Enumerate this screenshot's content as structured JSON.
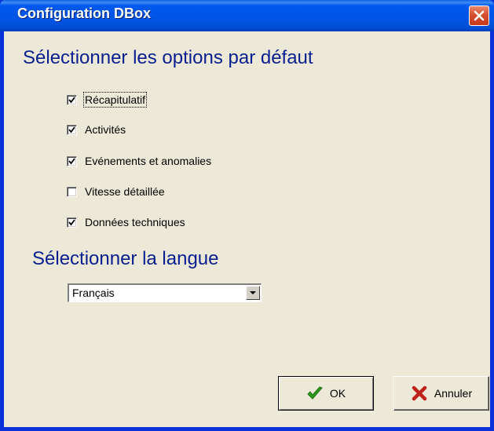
{
  "window": {
    "title": "Configuration DBox"
  },
  "options_section": {
    "heading": "Sélectionner les options par défaut",
    "options": [
      {
        "label": "Récapitulatif",
        "checked": true
      },
      {
        "label": "Activités",
        "checked": true
      },
      {
        "label": "Evénements et anomalies",
        "checked": true
      },
      {
        "label": "Vitesse détaillée",
        "checked": false
      },
      {
        "label": "Données techniques",
        "checked": true
      }
    ]
  },
  "language_section": {
    "heading": "Sélectionner la langue",
    "selected": "Français"
  },
  "buttons": {
    "ok_label": "OK",
    "ok_icon": "checkmark-icon",
    "cancel_label": "Annuler",
    "cancel_icon": "red-x-icon"
  },
  "colors": {
    "title_bar": "#0055e5",
    "frame": "#0831d9",
    "dialog_background": "#ece9d8",
    "heading_text": "#0a1f8f",
    "ok_icon": "#2f9e1f",
    "cancel_icon": "#c0221b"
  }
}
